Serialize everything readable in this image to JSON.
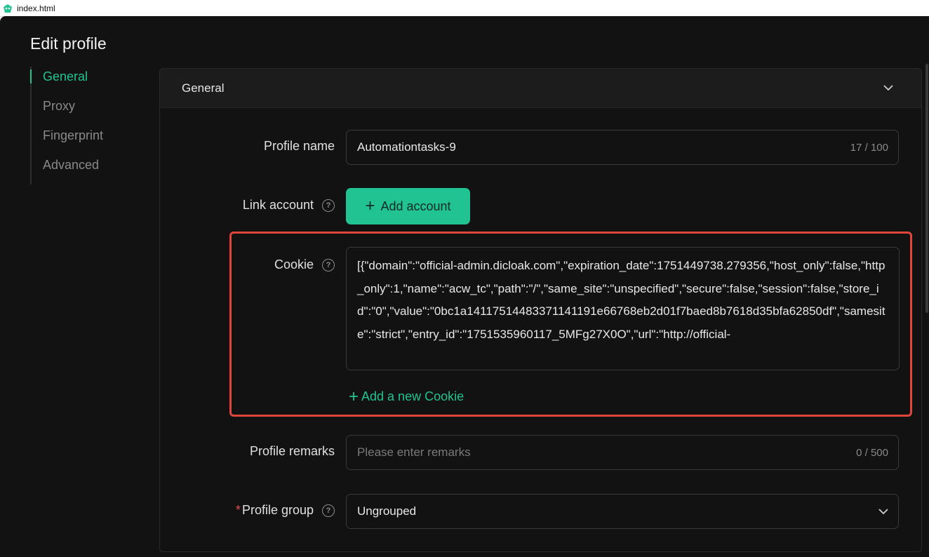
{
  "window": {
    "title": "index.html"
  },
  "page": {
    "title": "Edit profile"
  },
  "nav": {
    "items": [
      {
        "label": "General"
      },
      {
        "label": "Proxy"
      },
      {
        "label": "Fingerprint"
      },
      {
        "label": "Advanced"
      }
    ]
  },
  "section": {
    "title": "General"
  },
  "profile_name": {
    "label": "Profile name",
    "value": "Automationtasks-9",
    "counter": "17 / 100"
  },
  "link_account": {
    "label": "Link account",
    "button_label": "Add account"
  },
  "cookie": {
    "label": "Cookie",
    "value": "[{\"domain\":\"official-admin.dicloak.com\",\"expiration_date\":1751449738.279356,\"host_only\":false,\"http_only\":1,\"name\":\"acw_tc\",\"path\":\"/\",\"same_site\":\"unspecified\",\"secure\":false,\"session\":false,\"store_id\":\"0\",\"value\":\"0bc1a14117514483371141191e66768eb2d01f7baed8b7618d35bfa62850df\",\"samesite\":\"strict\",\"entry_id\":\"1751535960117_5MFg27X0O\",\"url\":\"http://official-",
    "add_label": "Add a new Cookie"
  },
  "remarks": {
    "label": "Profile remarks",
    "placeholder": "Please enter remarks",
    "counter": "0 / 500"
  },
  "group": {
    "label": "Profile group",
    "required_mark": "*",
    "value": "Ungrouped"
  },
  "colors": {
    "accent": "#21c392",
    "highlight": "#e0463c",
    "background": "#121212"
  }
}
